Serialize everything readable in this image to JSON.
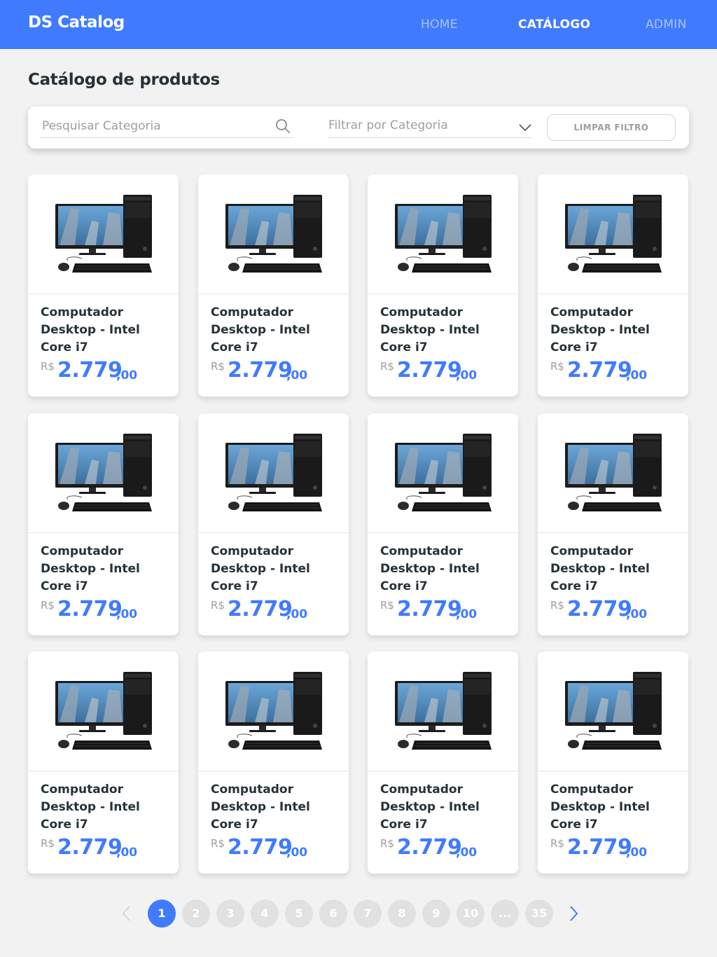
{
  "navbar": {
    "brand": "DS Catalog",
    "links": [
      {
        "label": "HOME",
        "active": false
      },
      {
        "label": "CATÁLOGO",
        "active": true
      },
      {
        "label": "ADMIN",
        "active": false
      }
    ]
  },
  "page_title": "Catálogo de produtos",
  "filter": {
    "search_placeholder": "Pesquisar Categoria",
    "search_value": "",
    "category_placeholder": "Filtrar por Categoria",
    "clear_label": "LIMPAR FILTRO"
  },
  "products": [
    {
      "name": "Computador Desktop - Intel Core i7",
      "currency": "R$",
      "price_int": "2.779",
      "price_dec": ",00"
    },
    {
      "name": "Computador Desktop - Intel Core i7",
      "currency": "R$",
      "price_int": "2.779",
      "price_dec": ",00"
    },
    {
      "name": "Computador Desktop - Intel Core i7",
      "currency": "R$",
      "price_int": "2.779",
      "price_dec": ",00"
    },
    {
      "name": "Computador Desktop - Intel Core i7",
      "currency": "R$",
      "price_int": "2.779",
      "price_dec": ",00"
    },
    {
      "name": "Computador Desktop - Intel Core i7",
      "currency": "R$",
      "price_int": "2.779",
      "price_dec": ",00"
    },
    {
      "name": "Computador Desktop - Intel Core i7",
      "currency": "R$",
      "price_int": "2.779",
      "price_dec": ",00"
    },
    {
      "name": "Computador Desktop - Intel Core i7",
      "currency": "R$",
      "price_int": "2.779",
      "price_dec": ",00"
    },
    {
      "name": "Computador Desktop - Intel Core i7",
      "currency": "R$",
      "price_int": "2.779",
      "price_dec": ",00"
    },
    {
      "name": "Computador Desktop - Intel Core i7",
      "currency": "R$",
      "price_int": "2.779",
      "price_dec": ",00"
    },
    {
      "name": "Computador Desktop - Intel Core i7",
      "currency": "R$",
      "price_int": "2.779",
      "price_dec": ",00"
    },
    {
      "name": "Computador Desktop - Intel Core i7",
      "currency": "R$",
      "price_int": "2.779",
      "price_dec": ",00"
    },
    {
      "name": "Computador Desktop - Intel Core i7",
      "currency": "R$",
      "price_int": "2.779",
      "price_dec": ",00"
    }
  ],
  "pagination": {
    "pages": [
      "1",
      "2",
      "3",
      "4",
      "5",
      "6",
      "7",
      "8",
      "9",
      "10",
      "...",
      "35"
    ],
    "active": "1",
    "prev_icon": "chevron-left-icon",
    "next_icon": "chevron-right-icon"
  },
  "colors": {
    "primary": "#407bff",
    "background": "#f2f2f2",
    "text": "#263238",
    "muted": "#9e9e9e",
    "page_inactive": "#e1e1e1"
  }
}
